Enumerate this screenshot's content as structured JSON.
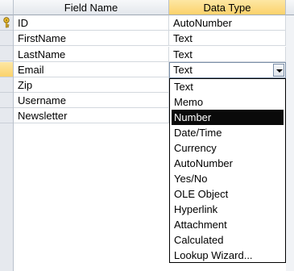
{
  "columns": {
    "field_name": "Field Name",
    "data_type": "Data Type"
  },
  "rows": [
    {
      "field": "ID",
      "type": "AutoNumber",
      "primary_key": true
    },
    {
      "field": "FirstName",
      "type": "Text"
    },
    {
      "field": "LastName",
      "type": "Text"
    },
    {
      "field": "Email",
      "type": "Text",
      "active": true
    },
    {
      "field": "Zip",
      "type": ""
    },
    {
      "field": "Username",
      "type": ""
    },
    {
      "field": "Newsletter",
      "type": ""
    }
  ],
  "combo": {
    "value": "Text"
  },
  "dropdown": {
    "options": [
      "Text",
      "Memo",
      "Number",
      "Date/Time",
      "Currency",
      "AutoNumber",
      "Yes/No",
      "OLE Object",
      "Hyperlink",
      "Attachment",
      "Calculated",
      "Lookup Wizard..."
    ],
    "highlighted": "Number"
  },
  "colors": {
    "header_active": "#fbd26b",
    "highlight_bg": "#0a0a0a",
    "highlight_fg": "#ffffff"
  },
  "icons": {
    "primary_key": "key-icon",
    "dropdown_arrow": "chevron-down-icon"
  }
}
